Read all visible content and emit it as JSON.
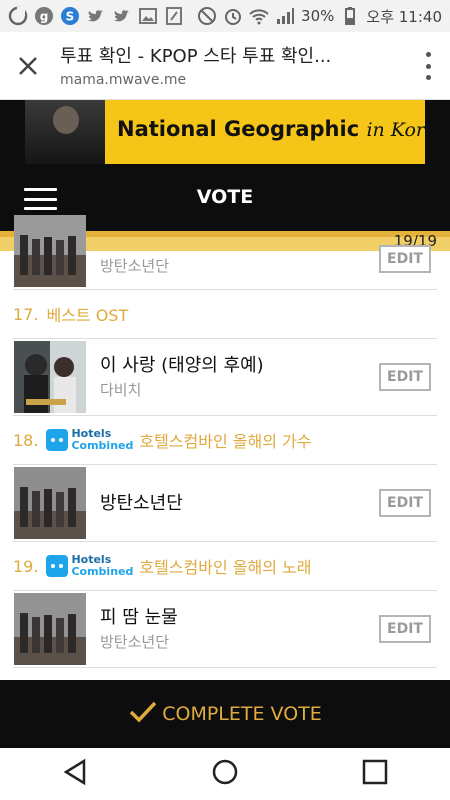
{
  "status_bar": {
    "battery": "30%",
    "time": "오후 11:40",
    "colors": {
      "text": "#444444"
    }
  },
  "browser": {
    "page_title": "투표 확인 - KPOP 스타 투표 확인...",
    "url": "mama.mwave.me"
  },
  "ad_banner": {
    "brand": "National Geographic",
    "tagline": "in Korea"
  },
  "header": {
    "title": "VOTE"
  },
  "progress": {
    "label": "19/19",
    "current": 19,
    "total": 19
  },
  "items": {
    "prev": {
      "artist": "방탄소년단",
      "edit": "EDIT"
    },
    "c17": {
      "number": "17.",
      "category": "베스트 OST",
      "song": "이 사랑 (태양의 후예)",
      "artist": "다비치",
      "edit": "EDIT"
    },
    "c18": {
      "number": "18.",
      "sponsor_line1": "Hotels",
      "sponsor_line2": "Combined",
      "category": "호텔스컴바인 올해의 가수",
      "song": "방탄소년단",
      "edit": "EDIT"
    },
    "c19": {
      "number": "19.",
      "sponsor_line1": "Hotels",
      "sponsor_line2": "Combined",
      "category": "호텔스컴바인 올해의 노래",
      "song": "피 땀 눈물",
      "artist": "방탄소년단",
      "edit": "EDIT"
    }
  },
  "footer": {
    "complete_label": "COMPLETE VOTE"
  },
  "theme": {
    "accent": "#e0aa3e",
    "dark": "#0d0d0d",
    "progress_bg": "#f0cf66",
    "sponsor_blue": "#1ea4e9"
  },
  "icons": {
    "close": "close-icon",
    "menu": "more-vert-icon",
    "hamburger": "hamburger-menu-icon",
    "check": "check-icon",
    "back": "back-triangle-icon",
    "home": "home-circle-icon",
    "recents": "recents-square-icon"
  }
}
